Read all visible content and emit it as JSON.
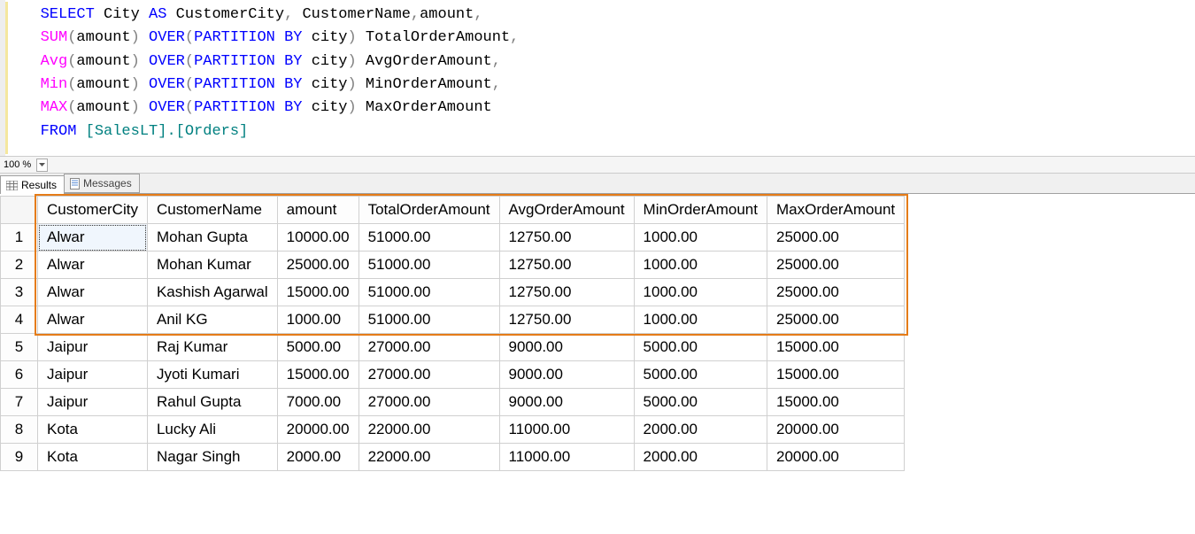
{
  "sql": {
    "select": "SELECT",
    "as": "AS",
    "city": "City",
    "customerCity": "CustomerCity",
    "comma": ",",
    "customerName": "CustomerName",
    "amount": "amount",
    "sum": "SUM",
    "avg": "Avg",
    "min": "Min",
    "max": "MAX",
    "lparen": "(",
    "rparen": ")",
    "over": "OVER",
    "partitionBy": "PARTITION BY",
    "cityLower": "city",
    "aliasTotal": "TotalOrderAmount",
    "aliasAvg": "AvgOrderAmount",
    "aliasMin": "MinOrderAmount",
    "aliasMax": "MaxOrderAmount",
    "from": "FROM",
    "tableRef": "[SalesLT].[Orders]",
    "dot": "."
  },
  "zoom": {
    "value": "100 %"
  },
  "tabs": {
    "results": "Results",
    "messages": "Messages"
  },
  "columns": [
    "CustomerCity",
    "CustomerName",
    "amount",
    "TotalOrderAmount",
    "AvgOrderAmount",
    "MinOrderAmount",
    "MaxOrderAmount"
  ],
  "rows": [
    {
      "n": "1",
      "CustomerCity": "Alwar",
      "CustomerName": "Mohan Gupta",
      "amount": "10000.00",
      "TotalOrderAmount": "51000.00",
      "AvgOrderAmount": "12750.00",
      "MinOrderAmount": "1000.00",
      "MaxOrderAmount": "25000.00"
    },
    {
      "n": "2",
      "CustomerCity": "Alwar",
      "CustomerName": "Mohan Kumar",
      "amount": "25000.00",
      "TotalOrderAmount": "51000.00",
      "AvgOrderAmount": "12750.00",
      "MinOrderAmount": "1000.00",
      "MaxOrderAmount": "25000.00"
    },
    {
      "n": "3",
      "CustomerCity": "Alwar",
      "CustomerName": "Kashish Agarwal",
      "amount": "15000.00",
      "TotalOrderAmount": "51000.00",
      "AvgOrderAmount": "12750.00",
      "MinOrderAmount": "1000.00",
      "MaxOrderAmount": "25000.00"
    },
    {
      "n": "4",
      "CustomerCity": "Alwar",
      "CustomerName": "Anil KG",
      "amount": "1000.00",
      "TotalOrderAmount": "51000.00",
      "AvgOrderAmount": "12750.00",
      "MinOrderAmount": "1000.00",
      "MaxOrderAmount": "25000.00"
    },
    {
      "n": "5",
      "CustomerCity": "Jaipur",
      "CustomerName": "Raj Kumar",
      "amount": "5000.00",
      "TotalOrderAmount": "27000.00",
      "AvgOrderAmount": "9000.00",
      "MinOrderAmount": "5000.00",
      "MaxOrderAmount": "15000.00"
    },
    {
      "n": "6",
      "CustomerCity": "Jaipur",
      "CustomerName": "Jyoti Kumari",
      "amount": "15000.00",
      "TotalOrderAmount": "27000.00",
      "AvgOrderAmount": "9000.00",
      "MinOrderAmount": "5000.00",
      "MaxOrderAmount": "15000.00"
    },
    {
      "n": "7",
      "CustomerCity": "Jaipur",
      "CustomerName": "Rahul Gupta",
      "amount": "7000.00",
      "TotalOrderAmount": "27000.00",
      "AvgOrderAmount": "9000.00",
      "MinOrderAmount": "5000.00",
      "MaxOrderAmount": "15000.00"
    },
    {
      "n": "8",
      "CustomerCity": "Kota",
      "CustomerName": "Lucky Ali",
      "amount": "20000.00",
      "TotalOrderAmount": "22000.00",
      "AvgOrderAmount": "11000.00",
      "MinOrderAmount": "2000.00",
      "MaxOrderAmount": "20000.00"
    },
    {
      "n": "9",
      "CustomerCity": "Kota",
      "CustomerName": "Nagar Singh",
      "amount": "2000.00",
      "TotalOrderAmount": "22000.00",
      "AvgOrderAmount": "11000.00",
      "MinOrderAmount": "2000.00",
      "MaxOrderAmount": "20000.00"
    }
  ]
}
